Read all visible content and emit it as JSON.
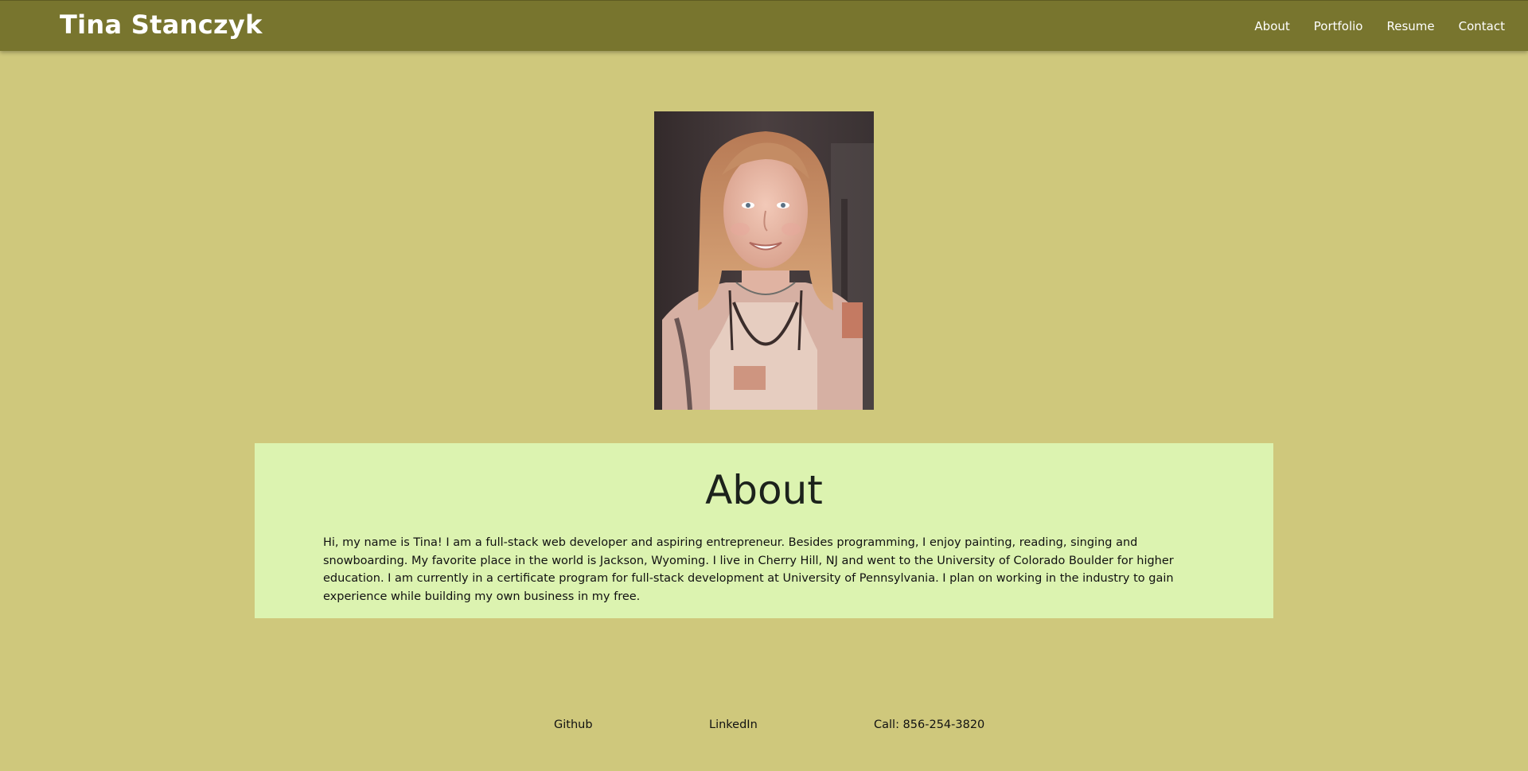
{
  "header": {
    "title": "Tina Stanczyk",
    "nav": [
      {
        "label": "About"
      },
      {
        "label": "Portfolio"
      },
      {
        "label": "Resume"
      },
      {
        "label": "Contact"
      }
    ]
  },
  "about": {
    "heading": "About",
    "body": "Hi, my name is Tina! I am a full-stack web developer and aspiring entrepreneur. Besides programming, I enjoy painting, reading, singing and snowboarding. My favorite place in the world is Jackson, Wyoming. I live in Cherry Hill, NJ and went to the University of Colorado Boulder for higher education. I am currently in a certificate program for full-stack development at University of Pennsylvania. I plan on working in the industry to gain experience while building my own business in my free."
  },
  "footer": {
    "github": "Github",
    "linkedin": "LinkedIn",
    "phone": "Call: 856-254-3820"
  },
  "colors": {
    "page_bg": "#cfc87c",
    "navbar_bg": "#78752e",
    "card_bg": "#dcf3b0"
  }
}
